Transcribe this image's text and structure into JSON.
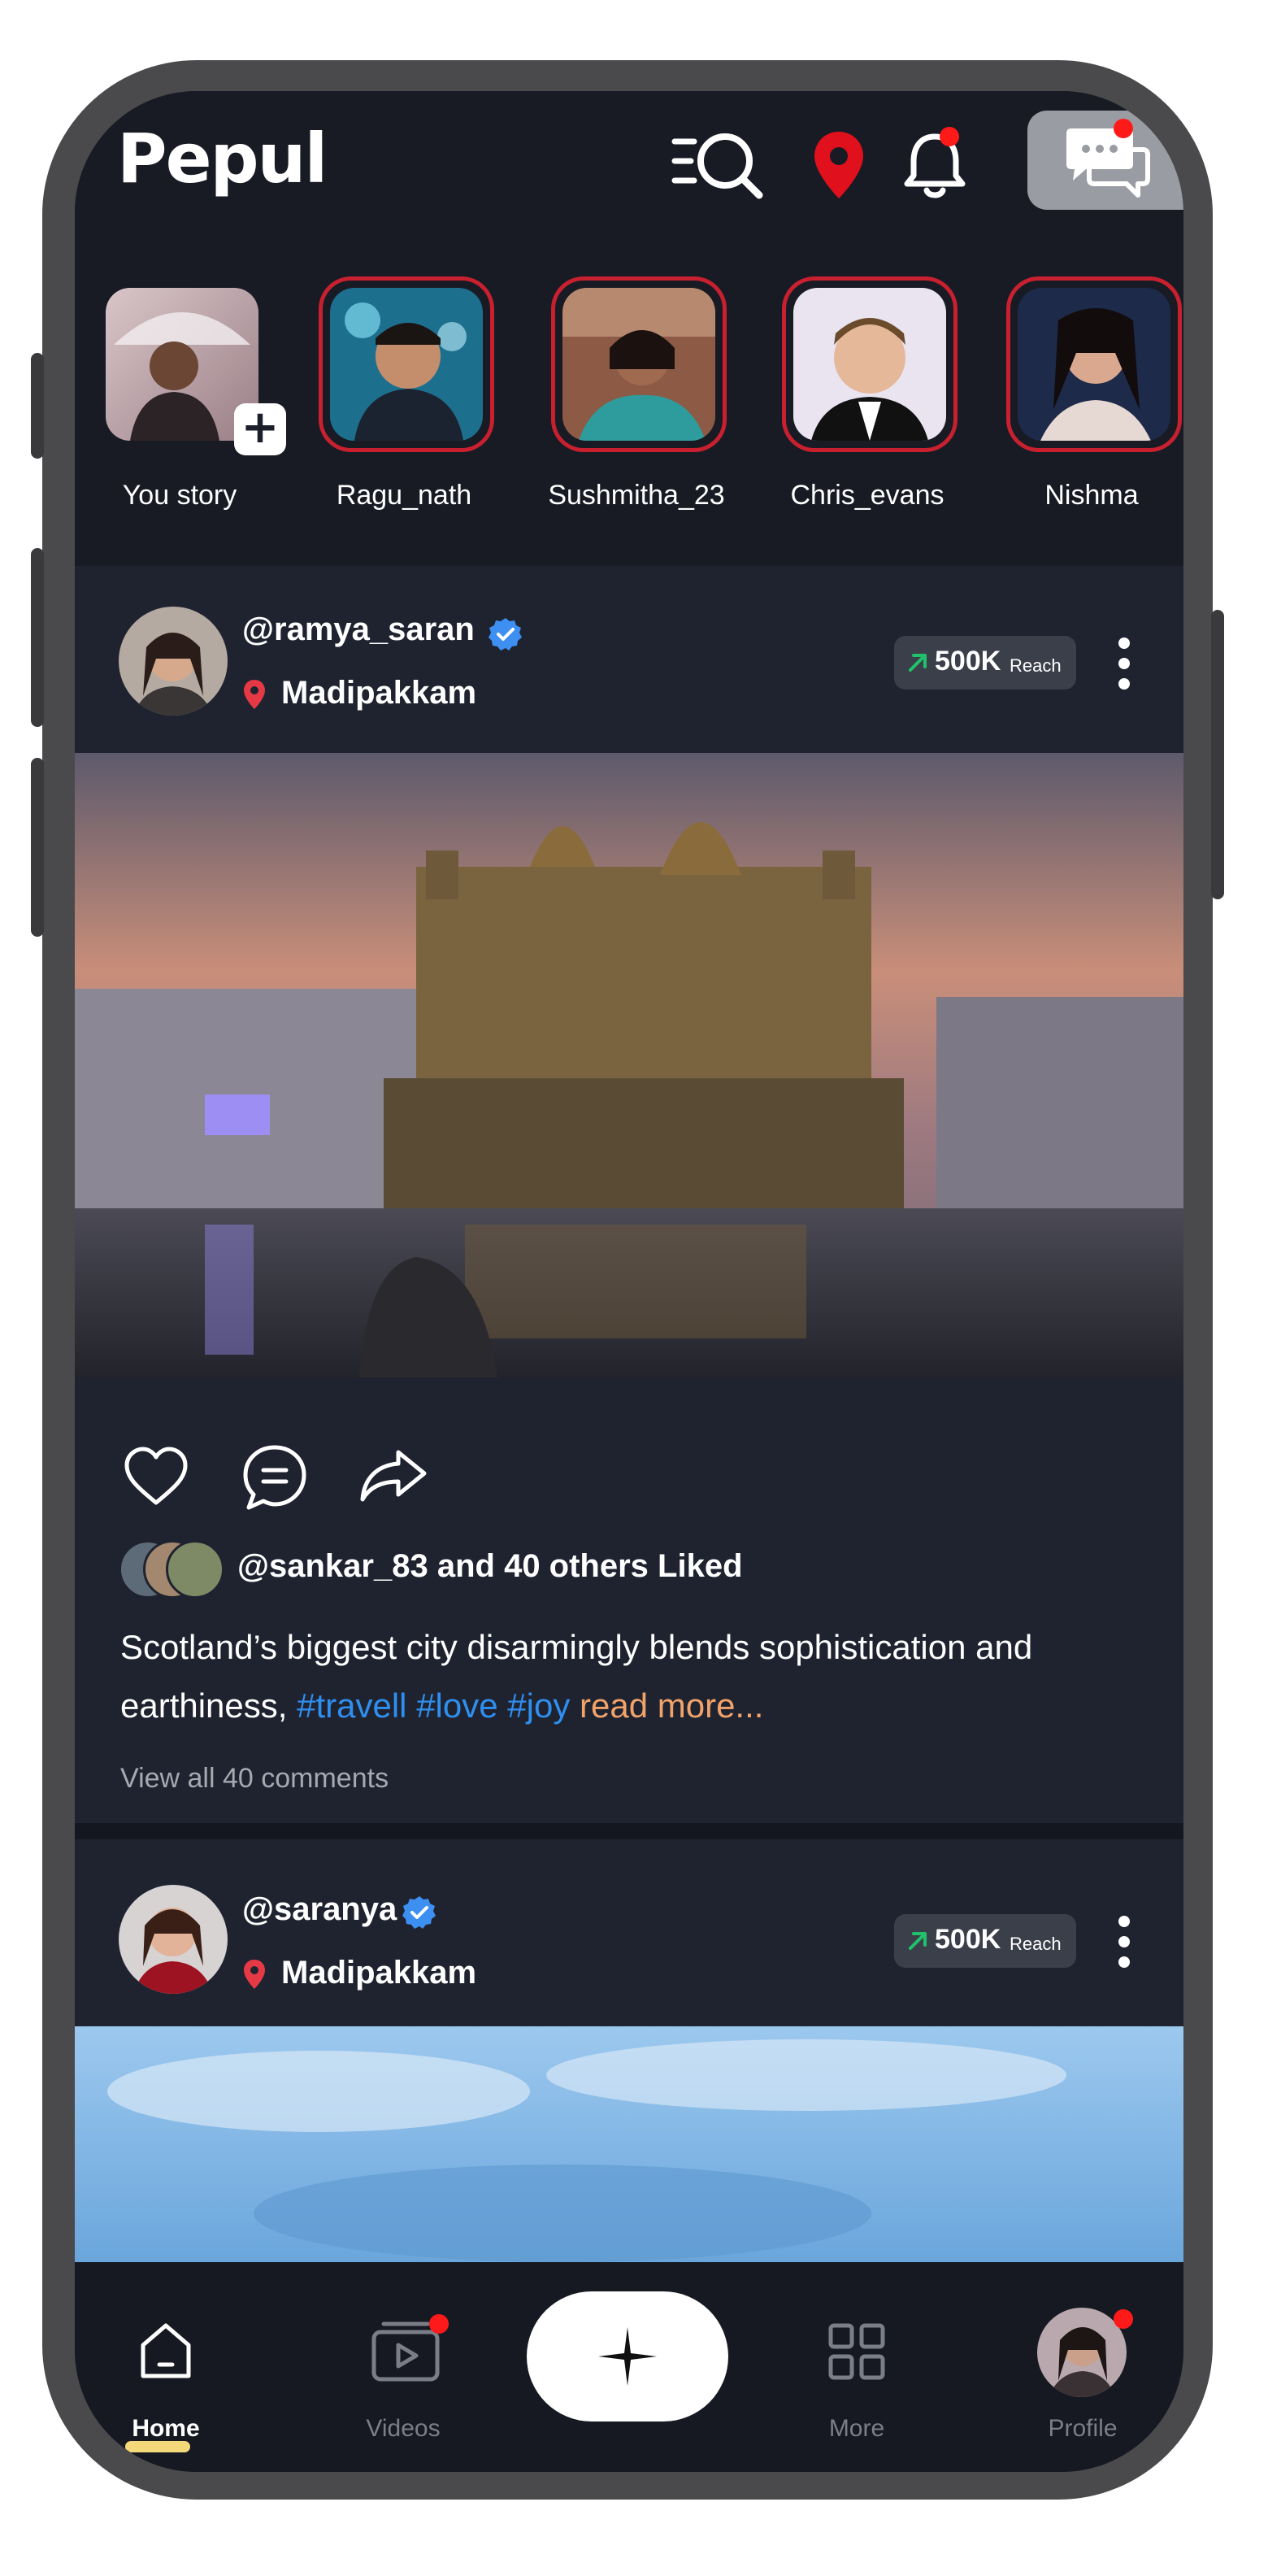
{
  "app": {
    "title": "Pepul"
  },
  "header": {
    "icons": [
      "menu-search-icon",
      "location-pin-icon",
      "bell-icon",
      "chat-icon"
    ],
    "accent": "#e0101c"
  },
  "stories": [
    {
      "name": "You story",
      "own": true
    },
    {
      "name": "Ragu_nath",
      "own": false
    },
    {
      "name": "Sushmitha_23",
      "own": false
    },
    {
      "name": "Chris_evans",
      "own": false
    },
    {
      "name": "Nishma",
      "own": false
    }
  ],
  "posts": [
    {
      "handle": "@ramya_saran",
      "verified": true,
      "location": "Madipakkam",
      "reach_value": "500K",
      "reach_unit": "Reach",
      "liked_by": "@sankar_83 and 40 others Liked",
      "caption_text": "Scotland’s biggest city disarmingly blends sophistication and earthiness,",
      "hashtags": [
        "#travell",
        "#love",
        "#joy"
      ],
      "read_more": "read more...",
      "comments_link": "View all 40  comments"
    },
    {
      "handle": "@saranya",
      "verified": true,
      "location": "Madipakkam",
      "reach_value": "500K",
      "reach_unit": "Reach"
    }
  ],
  "bottom_nav": [
    {
      "label": "Home",
      "active": true
    },
    {
      "label": "Videos",
      "active": false
    },
    {
      "label": "More",
      "active": false
    },
    {
      "label": "Profile",
      "active": false
    }
  ]
}
